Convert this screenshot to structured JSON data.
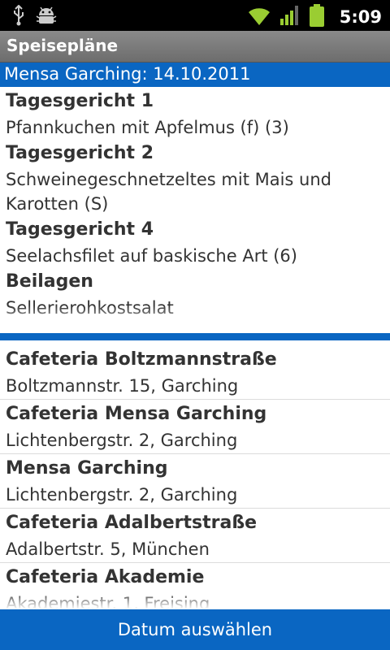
{
  "status_bar": {
    "time": "5:09",
    "icons": [
      "usb-icon",
      "android-debug-icon",
      "wifi-icon",
      "signal-icon",
      "battery-icon"
    ]
  },
  "app": {
    "title": "Speisepläne"
  },
  "menu": {
    "header": "Mensa Garching: 14.10.2011",
    "items": [
      {
        "category": "Tagesgericht 1",
        "name": "Pfannkuchen mit Apfelmus (f) (3)"
      },
      {
        "category": "Tagesgericht 2",
        "name": "Schweinegeschnetzeltes mit Mais und Karotten (S)"
      },
      {
        "category": "Tagesgericht 4",
        "name": "Seelachsfilet auf baskische Art (6)"
      },
      {
        "category": "Beilagen",
        "name": "Sellerierohkostsalat"
      }
    ]
  },
  "locations": [
    {
      "name": "Cafeteria Boltzmannstraße",
      "address": "Boltzmannstr. 15, Garching"
    },
    {
      "name": "Cafeteria Mensa Garching",
      "address": "Lichtenbergstr. 2, Garching"
    },
    {
      "name": "Mensa Garching",
      "address": "Lichtenbergstr. 2, Garching"
    },
    {
      "name": "Cafeteria Adalbertstraße",
      "address": "Adalbertstr. 5, München"
    },
    {
      "name": "Cafeteria Akademie",
      "address": "Akademiestr. 1, Freising"
    }
  ],
  "bottom_button": {
    "label": "Datum auswählen"
  },
  "colors": {
    "accent": "#0a66c2",
    "battery": "#9acd32",
    "signal": "#9acd32"
  }
}
